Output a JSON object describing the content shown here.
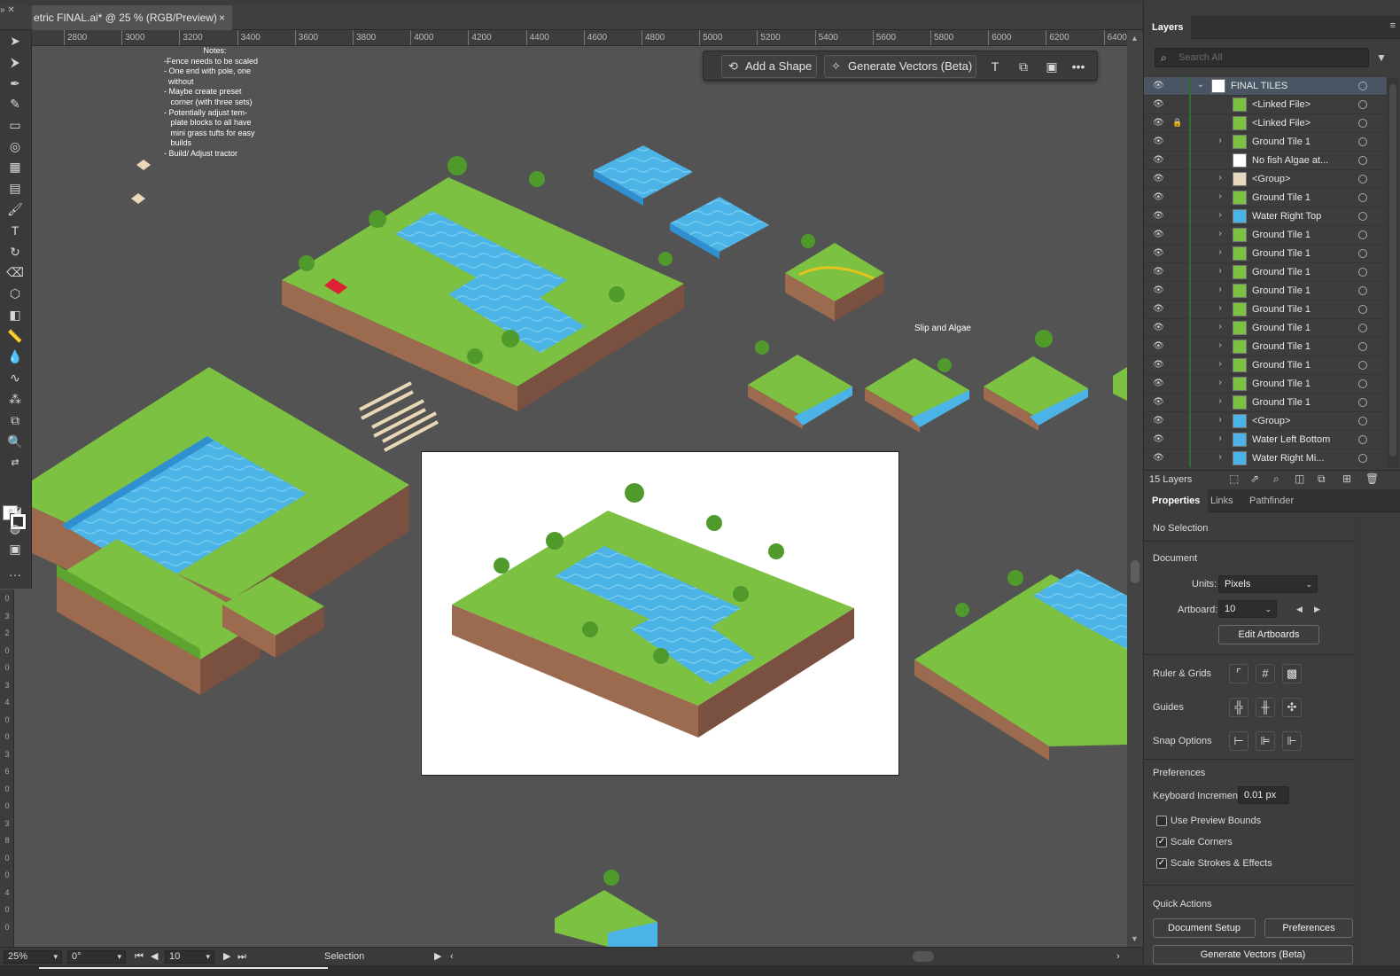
{
  "window": {
    "doc_tab_title": "etric FINAL.ai* @ 25 % (RGB/Preview)",
    "close_glyph": "×"
  },
  "ruler": {
    "h_ticks": [
      "2800",
      "3000",
      "3200",
      "3400",
      "3600",
      "3800",
      "4000",
      "4200",
      "4400",
      "4600",
      "4800",
      "5000",
      "5200",
      "5400",
      "5600",
      "5800",
      "6000",
      "6200",
      "6400"
    ],
    "v_labels": [
      "0",
      "3",
      "2",
      "0",
      "0",
      "3",
      "4",
      "0",
      "0",
      "3",
      "6",
      "0",
      "0",
      "3",
      "8",
      "0",
      "0",
      "4",
      "0",
      "0"
    ]
  },
  "canvas": {
    "notes_title": "Notes:",
    "notes_body": "-Fence needs to be scaled\n- One end with pole, one\n  without\n- Maybe create preset\n   corner (with three sets)\n- Potentially adjust tem-\n   plate blocks to all have\n   mini grass tufts for easy\n   builds\n- Build/ Adjust tractor",
    "slip_label": "Slip and Algae"
  },
  "hud": {
    "add_shape": "Add a Shape",
    "generate_vectors": "Generate Vectors (Beta)",
    "more": "•••"
  },
  "status": {
    "zoom": "25%",
    "rotation": "0°",
    "artboard": "10",
    "tool": "Selection"
  },
  "layers_panel": {
    "tab": "Layers",
    "search_placeholder": "Search All",
    "layers": [
      {
        "name": "FINAL TILES",
        "chevron": "⌄",
        "selected": true,
        "locked": false,
        "top": true,
        "thumb": "#ffffff"
      },
      {
        "name": "<Linked File>",
        "chevron": "",
        "selected": false,
        "locked": false,
        "top": false,
        "thumb": "#7cc142"
      },
      {
        "name": "<Linked File>",
        "chevron": "",
        "selected": false,
        "locked": true,
        "top": false,
        "thumb": "#7cc142"
      },
      {
        "name": "Ground Tile 1",
        "chevron": "›",
        "selected": false,
        "locked": false,
        "top": false,
        "thumb": "#7cc142"
      },
      {
        "name": "No fish Algae at...",
        "chevron": "",
        "selected": false,
        "locked": false,
        "top": false,
        "thumb": "#ffffff"
      },
      {
        "name": "<Group>",
        "chevron": "›",
        "selected": false,
        "locked": false,
        "top": false,
        "thumb": "#e8d8c0"
      },
      {
        "name": "Ground Tile 1",
        "chevron": "›",
        "selected": false,
        "locked": false,
        "top": false,
        "thumb": "#7cc142"
      },
      {
        "name": "Water Right Top",
        "chevron": "›",
        "selected": false,
        "locked": false,
        "top": false,
        "thumb": "#4bb3e6"
      },
      {
        "name": "Ground Tile 1",
        "chevron": "›",
        "selected": false,
        "locked": false,
        "top": false,
        "thumb": "#7cc142"
      },
      {
        "name": "Ground Tile 1",
        "chevron": "›",
        "selected": false,
        "locked": false,
        "top": false,
        "thumb": "#7cc142"
      },
      {
        "name": "Ground Tile 1",
        "chevron": "›",
        "selected": false,
        "locked": false,
        "top": false,
        "thumb": "#7cc142"
      },
      {
        "name": "Ground Tile 1",
        "chevron": "›",
        "selected": false,
        "locked": false,
        "top": false,
        "thumb": "#7cc142"
      },
      {
        "name": "Ground Tile 1",
        "chevron": "›",
        "selected": false,
        "locked": false,
        "top": false,
        "thumb": "#7cc142"
      },
      {
        "name": "Ground Tile 1",
        "chevron": "›",
        "selected": false,
        "locked": false,
        "top": false,
        "thumb": "#7cc142"
      },
      {
        "name": "Ground Tile 1",
        "chevron": "›",
        "selected": false,
        "locked": false,
        "top": false,
        "thumb": "#7cc142"
      },
      {
        "name": "Ground Tile 1",
        "chevron": "›",
        "selected": false,
        "locked": false,
        "top": false,
        "thumb": "#7cc142"
      },
      {
        "name": "Ground Tile 1",
        "chevron": "›",
        "selected": false,
        "locked": false,
        "top": false,
        "thumb": "#7cc142"
      },
      {
        "name": "Ground Tile 1",
        "chevron": "›",
        "selected": false,
        "locked": false,
        "top": false,
        "thumb": "#7cc142"
      },
      {
        "name": "<Group>",
        "chevron": "›",
        "selected": false,
        "locked": false,
        "top": false,
        "thumb": "#4bb3e6"
      },
      {
        "name": "Water Left Bottom",
        "chevron": "›",
        "selected": false,
        "locked": false,
        "top": false,
        "thumb": "#4bb3e6"
      },
      {
        "name": "Water Right Mi...",
        "chevron": "›",
        "selected": false,
        "locked": false,
        "top": false,
        "thumb": "#4bb3e6"
      }
    ],
    "count": "15 Layers"
  },
  "properties_panel": {
    "tabs": [
      "Properties",
      "Links",
      "Pathfinder"
    ],
    "no_selection": "No Selection",
    "document_heading": "Document",
    "units_label": "Units:",
    "units_value": "Pixels",
    "artboard_label": "Artboard:",
    "artboard_value": "10",
    "edit_artboards": "Edit Artboards",
    "ruler_grids": "Ruler & Grids",
    "guides": "Guides",
    "snap_options": "Snap Options",
    "preferences_heading": "Preferences",
    "keyboard_increment_label": "Keyboard Increment:",
    "keyboard_increment_value": "0.01 px",
    "use_preview_bounds": "Use Preview Bounds",
    "scale_corners": "Scale Corners",
    "scale_strokes": "Scale Strokes & Effects",
    "check_glyph": "✓",
    "checks": {
      "use_preview_bounds": false,
      "scale_corners": true,
      "scale_strokes": true
    },
    "quick_actions": "Quick Actions",
    "document_setup": "Document Setup",
    "preferences_btn": "Preferences",
    "generate_vectors": "Generate Vectors (Beta)"
  },
  "colors": {
    "accent_selected": "#4a5564",
    "grass": "#7cc142",
    "grass_dark": "#5ea52f",
    "dirt": "#9b6a4f",
    "water": "#4bb3e6",
    "water_dark": "#2f8fcf",
    "canvas_bg": "#535353"
  }
}
